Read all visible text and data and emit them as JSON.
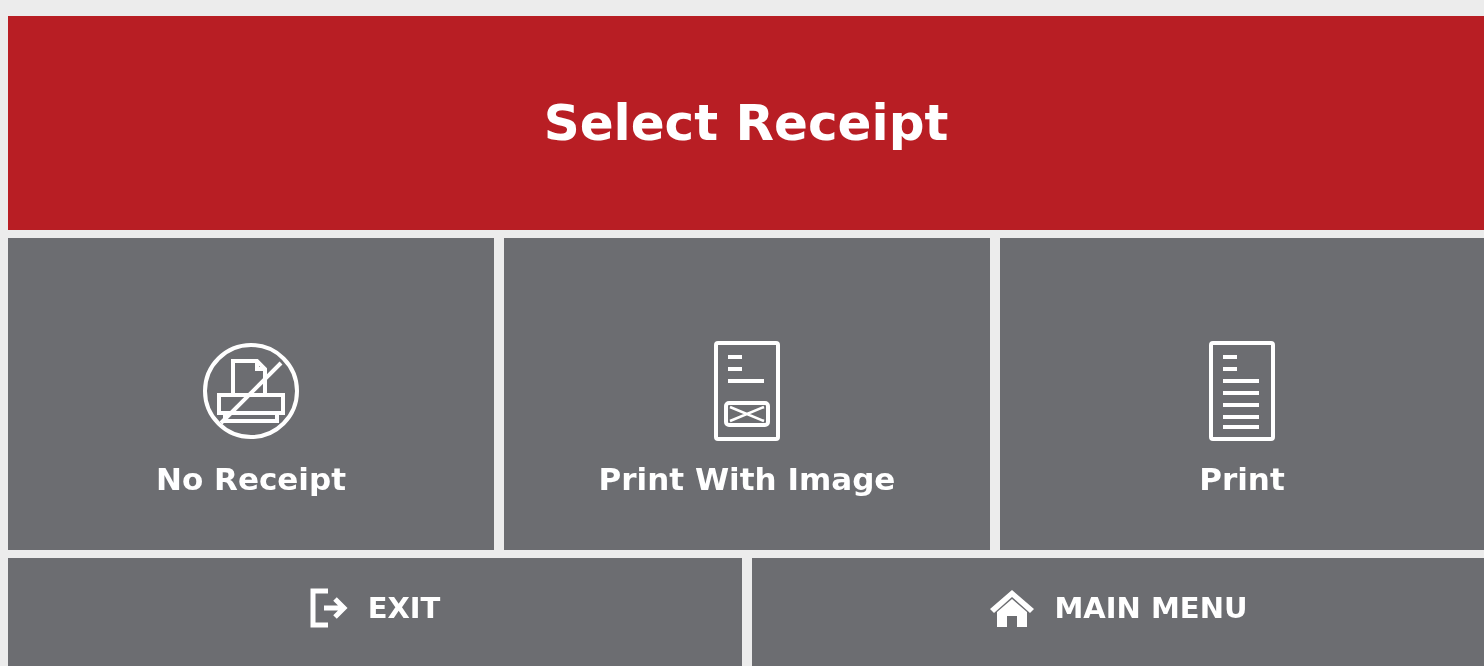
{
  "header": {
    "title": "Select Receipt"
  },
  "options": [
    {
      "label": "No Receipt",
      "kind": "no-receipt"
    },
    {
      "label": "Print With Image",
      "kind": "print-image"
    },
    {
      "label": "Print",
      "kind": "print"
    }
  ],
  "nav_buttons": [
    {
      "label": "EXIT",
      "kind": "exit"
    },
    {
      "label": "MAIN MENU",
      "kind": "home"
    }
  ]
}
